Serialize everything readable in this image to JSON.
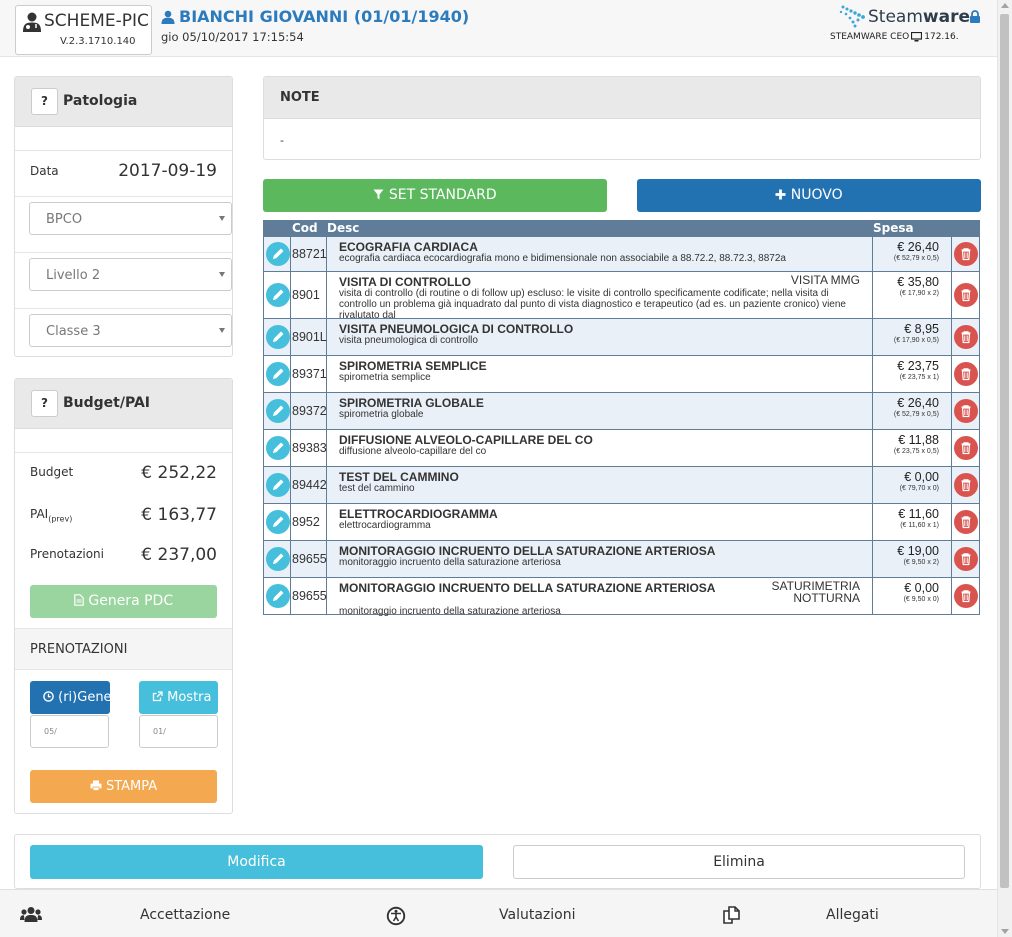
{
  "app": {
    "name": "SCHEME-PIC",
    "version": "V.2.3.1710.140"
  },
  "patient": {
    "name": "BIANCHI GIOVANNI (01/01/1940)",
    "datetime": "gio 05/10/2017 17:15:54"
  },
  "brand": {
    "name_light": "Steam",
    "name_bold": "ware",
    "user": "STEAMWARE CEO",
    "ip": "172.16."
  },
  "patologia": {
    "title": "Patologia",
    "help": "?",
    "data_label": "Data",
    "data_value": "2017-09-19",
    "selects": [
      "BPCO",
      "Livello 2",
      "Classe 3"
    ]
  },
  "budget": {
    "title": "Budget/PAI",
    "help": "?",
    "budget_label": "Budget",
    "budget_value": "€ 252,22",
    "pai_label": "PAI",
    "pai_sub": "(prev)",
    "pai_value": "€ 163,77",
    "pren_label": "Prenotazioni",
    "pren_value": "€ 237,00",
    "genera_label": "Genera PDC",
    "prenotazioni_title": "PRENOTAZIONI",
    "rigenera_label": "(ri)Gene",
    "mostra_label": "Mostra",
    "input1": "05/",
    "input2": "01/",
    "stampa_label": "STAMPA"
  },
  "note": {
    "title": "NOTE",
    "body": "-"
  },
  "actions": {
    "set_standard": "SET STANDARD",
    "nuovo": "NUOVO"
  },
  "table": {
    "headers": {
      "cod": "Cod",
      "desc": "Desc",
      "spesa": "Spesa"
    },
    "rows": [
      {
        "cod": "88721",
        "title": "ECOGRAFIA CARDIACA",
        "desc": "ecografia cardiaca ecocardiografia mono e bidimensionale non associabile a 88.72.2, 88.72.3, 8872a",
        "right": "",
        "spesa": "€ 26,40",
        "detail": "(€ 52,79 x 0,5)"
      },
      {
        "cod": "8901",
        "title": "VISITA DI CONTROLLO",
        "desc": "visita di controllo (di routine o di follow up) escluso: le visite di controllo specificamente codificate; nella visita di controllo un problema già inquadrato dal punto di vista diagnostico e terapeutico (ad es. un paziente cronico) viene rivalutato dal",
        "right": "VISITA MMG",
        "spesa": "€ 35,80",
        "detail": "(€ 17,90 x 2)"
      },
      {
        "cod": "8901L",
        "title": "VISITA PNEUMOLOGICA DI CONTROLLO",
        "desc": "visita pneumologica di controllo",
        "right": "",
        "spesa": "€ 8,95",
        "detail": "(€ 17,90 x 0,5)"
      },
      {
        "cod": "89371",
        "title": "SPIROMETRIA SEMPLICE",
        "desc": "spirometria semplice",
        "right": "",
        "spesa": "€ 23,75",
        "detail": "(€ 23,75 x 1)"
      },
      {
        "cod": "89372",
        "title": "SPIROMETRIA GLOBALE",
        "desc": "spirometria globale",
        "right": "",
        "spesa": "€ 26,40",
        "detail": "(€ 52,79 x 0,5)"
      },
      {
        "cod": "89383",
        "title": "DIFFUSIONE ALVEOLO-CAPILLARE DEL CO",
        "desc": "diffusione alveolo-capillare del co",
        "right": "",
        "spesa": "€ 11,88",
        "detail": "(€ 23,75 x 0,5)"
      },
      {
        "cod": "89442",
        "title": "TEST DEL CAMMINO",
        "desc": "test del cammino",
        "right": "",
        "spesa": "€ 0,00",
        "detail": "(€ 79,70 x 0)"
      },
      {
        "cod": "8952",
        "title": "ELETTROCARDIOGRAMMA",
        "desc": "elettrocardiogramma",
        "right": "",
        "spesa": "€ 11,60",
        "detail": "(€ 11,60 x 1)"
      },
      {
        "cod": "89655",
        "title": "MONITORAGGIO INCRUENTO DELLA SATURAZIONE ARTERIOSA",
        "desc": "monitoraggio incruento della saturazione arteriosa",
        "right": "",
        "spesa": "€ 19,00",
        "detail": "(€ 9,50 x 2)"
      },
      {
        "cod": "89655",
        "title": "MONITORAGGIO INCRUENTO DELLA SATURAZIONE ARTERIOSA",
        "desc": "monitoraggio incruento della saturazione arteriosa",
        "right": "SATURIMETRIA NOTTURNA",
        "spesa": "€ 0,00",
        "detail": "(€ 9,50 x 0)"
      }
    ]
  },
  "bottom": {
    "modifica": "Modifica",
    "elimina": "Elimina"
  },
  "footer": {
    "accettazione": "Accettazione",
    "valutazioni": "Valutazioni",
    "allegati": "Allegati"
  },
  "colors": {
    "primary": "#2271b1",
    "teal": "#45bfdb",
    "green": "#5bb85d",
    "orange": "#f4a84f",
    "danger": "#d9534f",
    "table_header": "#5f7d99"
  }
}
